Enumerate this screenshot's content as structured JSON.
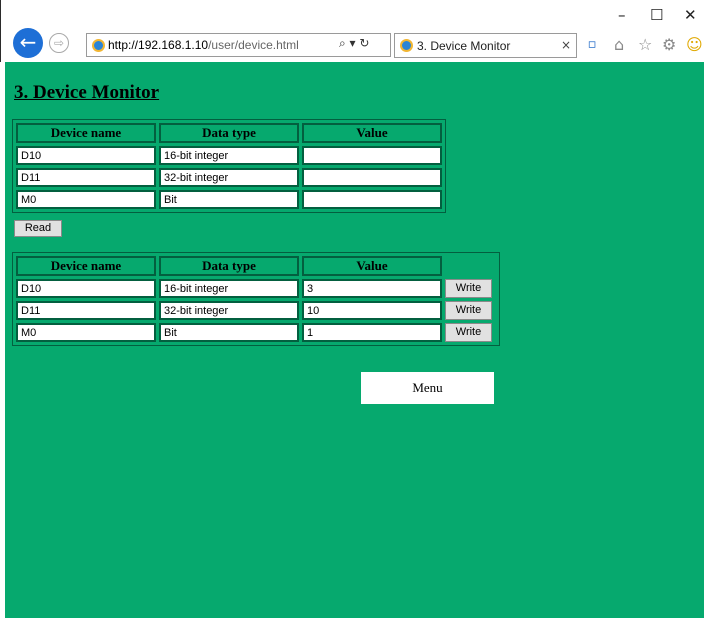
{
  "window": {
    "minimize": "–",
    "maximize": "☐",
    "close": "✕"
  },
  "browser": {
    "back": "←",
    "forward": "⇨",
    "address_host": "http://192.168.1.10",
    "address_path": "/user/device.html",
    "address_search": "⌕ ▾ ↻",
    "tab_title": "3. Device Monitor",
    "tab_close": "×",
    "new_tab": "▫",
    "toolbar_icons": {
      "home": "⌂",
      "favorites": "☆",
      "settings": "⚙",
      "feedback": "☺"
    }
  },
  "page": {
    "title": "3. Device Monitor",
    "read_table": {
      "headers": [
        "Device name",
        "Data type",
        "Value"
      ],
      "rows": [
        {
          "device": "D10",
          "type": "16-bit integer",
          "value": ""
        },
        {
          "device": "D11",
          "type": "32-bit integer",
          "value": ""
        },
        {
          "device": "M0",
          "type": "Bit",
          "value": ""
        }
      ],
      "read_label": "Read"
    },
    "write_table": {
      "headers": [
        "Device name",
        "Data type",
        "Value"
      ],
      "rows": [
        {
          "device": "D10",
          "type": "16-bit integer",
          "value": "3",
          "write_label": "Write"
        },
        {
          "device": "D11",
          "type": "32-bit integer",
          "value": "10",
          "write_label": "Write"
        },
        {
          "device": "M0",
          "type": "Bit",
          "value": "1",
          "write_label": "Write"
        }
      ]
    },
    "menu_label": "Menu"
  },
  "colors": {
    "page_background": "#06a96e",
    "table_border": "#035f3f",
    "ie_blue": "#1e6fd6"
  }
}
